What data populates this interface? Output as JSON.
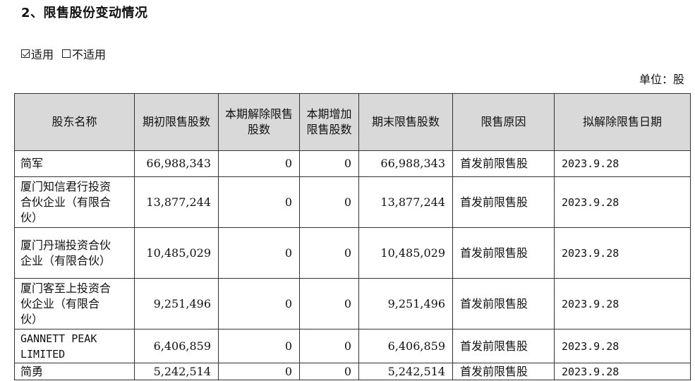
{
  "section_title": "2、限售股份变动情况",
  "options": {
    "applicable": "适用",
    "not_applicable": "不适用"
  },
  "unit_label": "单位：股",
  "table": {
    "headers": [
      "股东名称",
      "期初限售股数",
      "本期解除限售股数",
      "本期增加限售股数",
      "期末限售股数",
      "限售原因",
      "拟解除限售日期"
    ],
    "rows": [
      {
        "name": "简军",
        "begin": "66,988,343",
        "released": "0",
        "added": "0",
        "end": "66,988,343",
        "reason": "首发前限售股",
        "date": "2023.9.28"
      },
      {
        "name": "厦门知信君行投资合伙企业（有限合伙）",
        "begin": "13,877,244",
        "released": "0",
        "added": "0",
        "end": "13,877,244",
        "reason": "首发前限售股",
        "date": "2023.9.28"
      },
      {
        "name": "厦门丹瑞投资合伙企业（有限合伙）",
        "begin": "10,485,029",
        "released": "0",
        "added": "0",
        "end": "10,485,029",
        "reason": "首发前限售股",
        "date": "2023.9.28"
      },
      {
        "name": "厦门客至上投资合伙企业（有限合伙）",
        "begin": "9,251,496",
        "released": "0",
        "added": "0",
        "end": "9,251,496",
        "reason": "首发前限售股",
        "date": "2023.9.28"
      },
      {
        "name": "GANNETT PEAK LIMITED",
        "begin": "6,406,859",
        "released": "0",
        "added": "0",
        "end": "6,406,859",
        "reason": "首发前限售股",
        "date": "2023.9.28"
      },
      {
        "name": "简勇",
        "begin": "5,242,514",
        "released": "0",
        "added": "0",
        "end": "5,242,514",
        "reason": "首发前限售股",
        "date": "2023.9.28"
      }
    ]
  }
}
